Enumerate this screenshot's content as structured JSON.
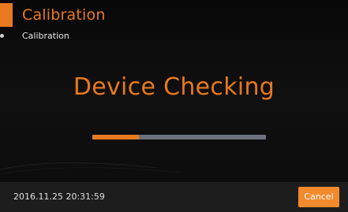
{
  "header": {
    "title": "Calibration"
  },
  "breadcrumb": {
    "label": "Calibration"
  },
  "status": {
    "heading": "Device Checking"
  },
  "progress": {
    "percent": 27
  },
  "footer": {
    "timestamp": "2016.11.25  20:31:59",
    "cancel_label": "Cancel"
  },
  "colors": {
    "accent": "#e8791f",
    "button": "#f08a2c",
    "track": "#6e7280"
  }
}
